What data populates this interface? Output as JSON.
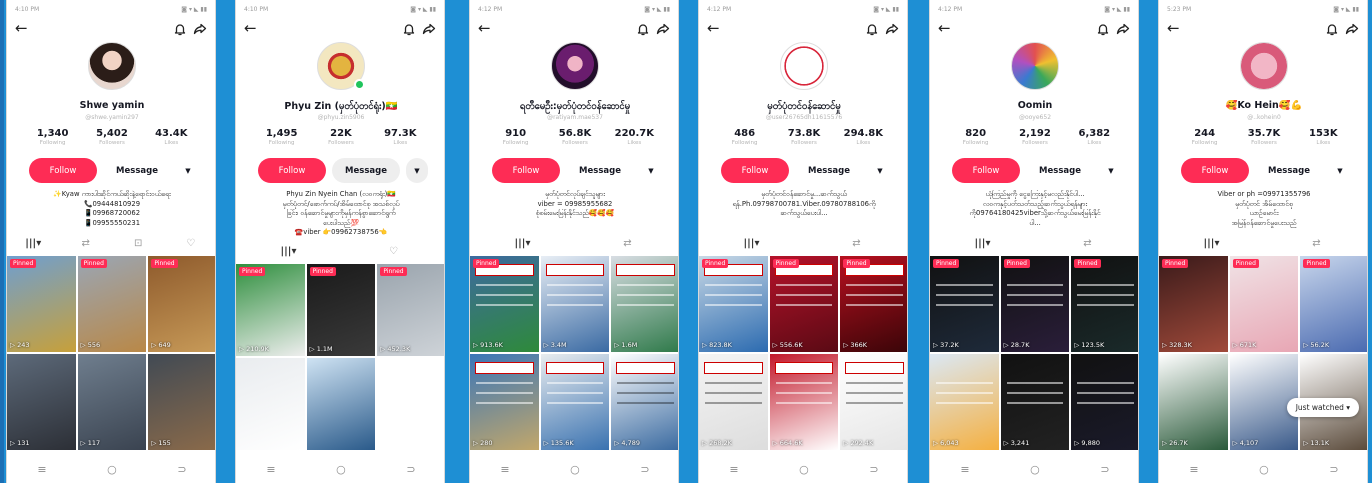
{
  "phones": [
    {
      "time": "4:10 PM",
      "name": "Shwe yamin",
      "handle": "@shwe.yamin297",
      "stats": [
        {
          "value": "1,340",
          "label": "Following"
        },
        {
          "value": "5,402",
          "label": "Followers"
        },
        {
          "value": "43.4K",
          "label": "Likes"
        }
      ],
      "follow_label": "Follow",
      "message_label": "Message",
      "more_label": "▼",
      "bio": [
        "✨Kyaw ကားပါးဆိုင်ကယ်ဆိုးနဲ့ရောင်းဝယ်ရေး",
        "📞09444810929",
        "📱09968720062",
        "📱09955550231"
      ],
      "tabs": [
        "|||▾",
        "⇄",
        "⊡",
        "♡"
      ],
      "tiles": [
        {
          "pinned": "Pinned",
          "views": "▷ 243",
          "colors": [
            "#6f9fd0",
            "#c7a03a"
          ]
        },
        {
          "pinned": "Pinned",
          "views": "▷ 556",
          "colors": [
            "#9aa6b5",
            "#b98847"
          ]
        },
        {
          "pinned": "Pinned",
          "views": "▷ 649",
          "colors": [
            "#8e5a2c",
            "#c79a58"
          ]
        },
        {
          "pinned": "",
          "views": "▷ 131",
          "colors": [
            "#5d6a7a",
            "#2c2f36"
          ]
        },
        {
          "pinned": "",
          "views": "▷ 117",
          "colors": [
            "#6f7e8e",
            "#3a4350"
          ]
        },
        {
          "pinned": "",
          "views": "▷ 155",
          "colors": [
            "#414a54",
            "#8a6a4a"
          ]
        }
      ]
    },
    {
      "time": "4:10 PM",
      "name": "Phyu Zin (မှတ်ပုံတင်ရုံး)🇲🇲",
      "handle": "@phyu.zin5906",
      "stats": [
        {
          "value": "1,495",
          "label": "Following"
        },
        {
          "value": "22K",
          "label": "Followers"
        },
        {
          "value": "97.3K",
          "label": "Likes"
        }
      ],
      "follow_label": "Follow",
      "message_label": "Message",
      "more_label": "▼",
      "bio": [
        "Phyu Zin Nyein Chan (လဝကရုံး)🇲🇲",
        "မှတ်ပုံတင်/ဖောက်ကပ်/အိမ်ထောင်စု အသစ်လုပ်",
        "ခြင်း၊ ဝန်ဆောင်မှုများကိုမှန်ကန်စွာဆောင်ရွက်",
        "ပေးပါသည်💯",
        "☎️viber 👉09962738756👈"
      ],
      "tabs": [
        "|||▾",
        "♡"
      ],
      "tiles": [
        {
          "pinned": "Pinned",
          "views": "▷ 210.9K",
          "colors": [
            "#2f8f3e",
            "#eeeeee"
          ]
        },
        {
          "pinned": "Pinned",
          "views": "▷ 1.1M",
          "colors": [
            "#1a1a1a",
            "#3a3a3a"
          ]
        },
        {
          "pinned": "Pinned",
          "views": "▷ 452.3K",
          "colors": [
            "#9aa4ad",
            "#ced3d8"
          ]
        },
        {
          "pinned": "",
          "views": "",
          "colors": [
            "#e9ecef",
            "#ffffff"
          ]
        },
        {
          "pinned": "",
          "views": "",
          "colors": [
            "#cfe3f3",
            "#2a5a8a"
          ]
        },
        {
          "pinned": "",
          "views": "",
          "colors": [
            "#ffffff",
            "#ffffff"
          ]
        }
      ]
    },
    {
      "time": "4:12 PM",
      "name": "ရတီမေဦး:မှတ်ပုံတင်ဝန်ဆောင်မှု",
      "handle": "@ratiyam.mae537",
      "stats": [
        {
          "value": "910",
          "label": "Following"
        },
        {
          "value": "56.8K",
          "label": "Followers"
        },
        {
          "value": "220.7K",
          "label": "Likes"
        }
      ],
      "follow_label": "Follow",
      "message_label": "Message",
      "more_label": "▼",
      "bio": [
        "မှတ်ပုံတင်လုပ်ချင်သူများ",
        "viber = 09985955682",
        "စုံစမ်းမေးမြန်းနိုင်သည်🥰🥰🥰"
      ],
      "tabs": [
        "|||▾",
        "⇄"
      ],
      "tiles": [
        {
          "pinned": "Pinned",
          "views": "▷ 913.6K",
          "colors": [
            "#3d6aa0",
            "#2e8a3a"
          ]
        },
        {
          "pinned": "",
          "views": "▷ 3.4M",
          "colors": [
            "#e8eef5",
            "#3a6aa3"
          ]
        },
        {
          "pinned": "",
          "views": "▷ 1.6M",
          "colors": [
            "#d8dde3",
            "#2f7a4a"
          ]
        },
        {
          "pinned": "",
          "views": "▷ 280",
          "colors": [
            "#3a76b8",
            "#c2a76a"
          ]
        },
        {
          "pinned": "",
          "views": "▷ 135.6K",
          "colors": [
            "#e8ecef",
            "#3a72b0"
          ]
        },
        {
          "pinned": "",
          "views": "▷ 4,789",
          "colors": [
            "#ffffff",
            "#3a6aa0"
          ]
        }
      ]
    },
    {
      "time": "4:12 PM",
      "name": "မှတ်ပုံတင်ဝန်ဆောင်မှု",
      "handle": "@user26765dh11615576",
      "stats": [
        {
          "value": "486",
          "label": "Following"
        },
        {
          "value": "73.8K",
          "label": "Followers"
        },
        {
          "value": "294.8K",
          "label": "Likes"
        }
      ],
      "follow_label": "Follow",
      "message_label": "Message",
      "more_label": "▼",
      "bio": [
        "မှတ်ပုံတင်ဝန်ဆောင်မှု...ဆက်သွယ်",
        "ရန်.Ph.09798700781.Viber.09780788106ကို",
        "ဆက်သွယ်ပေးပါ..."
      ],
      "tabs": [
        "|||▾",
        "⇄"
      ],
      "tiles": [
        {
          "pinned": "Pinned",
          "views": "▷ 823.8K",
          "colors": [
            "#c9d9e6",
            "#2c6bb0"
          ]
        },
        {
          "pinned": "Pinned",
          "views": "▷ 556.6K",
          "colors": [
            "#b5122a",
            "#5a0a14"
          ]
        },
        {
          "pinned": "Pinned",
          "views": "▷ 366K",
          "colors": [
            "#b7101f",
            "#3a0508"
          ]
        },
        {
          "pinned": "",
          "views": "▷ 268.2K",
          "colors": [
            "#f4f4f4",
            "#dddddd"
          ]
        },
        {
          "pinned": "",
          "views": "▷ 664.6K",
          "colors": [
            "#c2182a",
            "#ffffff"
          ]
        },
        {
          "pinned": "",
          "views": "▷ 292.4K",
          "colors": [
            "#ffffff",
            "#e6e6e6"
          ]
        }
      ]
    },
    {
      "time": "4:12 PM",
      "name": "Oomin",
      "handle": "@ooye652",
      "stats": [
        {
          "value": "820",
          "label": "Following"
        },
        {
          "value": "2,192",
          "label": "Followers"
        },
        {
          "value": "6,382",
          "label": "Likes"
        }
      ],
      "follow_label": "Follow",
      "message_label": "Message",
      "more_label": "▼",
      "bio": [
        "ယုံကြည်မှုကို ငွေကြေးနှင့်မလည်းနိုင်ပါ...",
        "လဝကနှင့်ပတ်သတ်သည့်ဆက်သွယ်ရန်များ",
        "ကို09764180425viberသို့ဆက်သွယ်မေးမြန်းနိုင်",
        "ပါ..."
      ],
      "tabs": [
        "|||▾",
        "⇄"
      ],
      "tiles": [
        {
          "pinned": "Pinned",
          "views": "▷ 37.2K",
          "colors": [
            "#111111",
            "#1e2a3a"
          ]
        },
        {
          "pinned": "Pinned",
          "views": "▷ 28.7K",
          "colors": [
            "#111111",
            "#2a1e3a"
          ]
        },
        {
          "pinned": "Pinned",
          "views": "▷ 123.5K",
          "colors": [
            "#111111",
            "#1a2a2a"
          ]
        },
        {
          "pinned": "",
          "views": "▷ 6,043",
          "colors": [
            "#dbe8f4",
            "#f5b040"
          ]
        },
        {
          "pinned": "",
          "views": "▷ 3,241",
          "colors": [
            "#111111",
            "#222222"
          ]
        },
        {
          "pinned": "",
          "views": "▷ 9,880",
          "colors": [
            "#111111",
            "#1a1a2a"
          ]
        }
      ]
    },
    {
      "time": "5:23 PM",
      "name": "🥰Ko Hein🥰💪",
      "handle": "@..kohein0",
      "stats": [
        {
          "value": "244",
          "label": "Following"
        },
        {
          "value": "35.7K",
          "label": "Followers"
        },
        {
          "value": "153K",
          "label": "Likes"
        }
      ],
      "follow_label": "Follow",
      "message_label": "Message",
      "more_label": "▼",
      "bio": [
        "Viber or ph =09971355796",
        "မှတ်ပုံတင် အိမ်ထောင်စု",
        "ယာဉ်မောင်း",
        "အမြန်ဝန်ဆောင်မှုပေးသည်"
      ],
      "tabs": [
        "|||▾",
        "⇄"
      ],
      "tiles": [
        {
          "pinned": "Pinned",
          "views": "▷ 328.3K",
          "colors": [
            "#3a1a1a",
            "#a04a3a"
          ]
        },
        {
          "pinned": "Pinned",
          "views": "▷ 671K",
          "colors": [
            "#f0e3e6",
            "#e8a6b4"
          ]
        },
        {
          "pinned": "Pinned",
          "views": "▷ 56.2K",
          "colors": [
            "#c8d6ec",
            "#4a6ab0"
          ]
        },
        {
          "pinned": "",
          "views": "▷ 26.7K",
          "colors": [
            "#ffffff",
            "#2a5a3a"
          ]
        },
        {
          "pinned": "",
          "views": "▷ 4,107",
          "colors": [
            "#ffffff",
            "#3a5a8a"
          ]
        },
        {
          "pinned": "",
          "views": "▷ 13.1K",
          "colors": [
            "#ffffff",
            "#5a4a3a"
          ]
        }
      ],
      "just_watched": "Just watched ▾"
    }
  ],
  "nav_icons": [
    "≡",
    "○",
    "⊃"
  ]
}
